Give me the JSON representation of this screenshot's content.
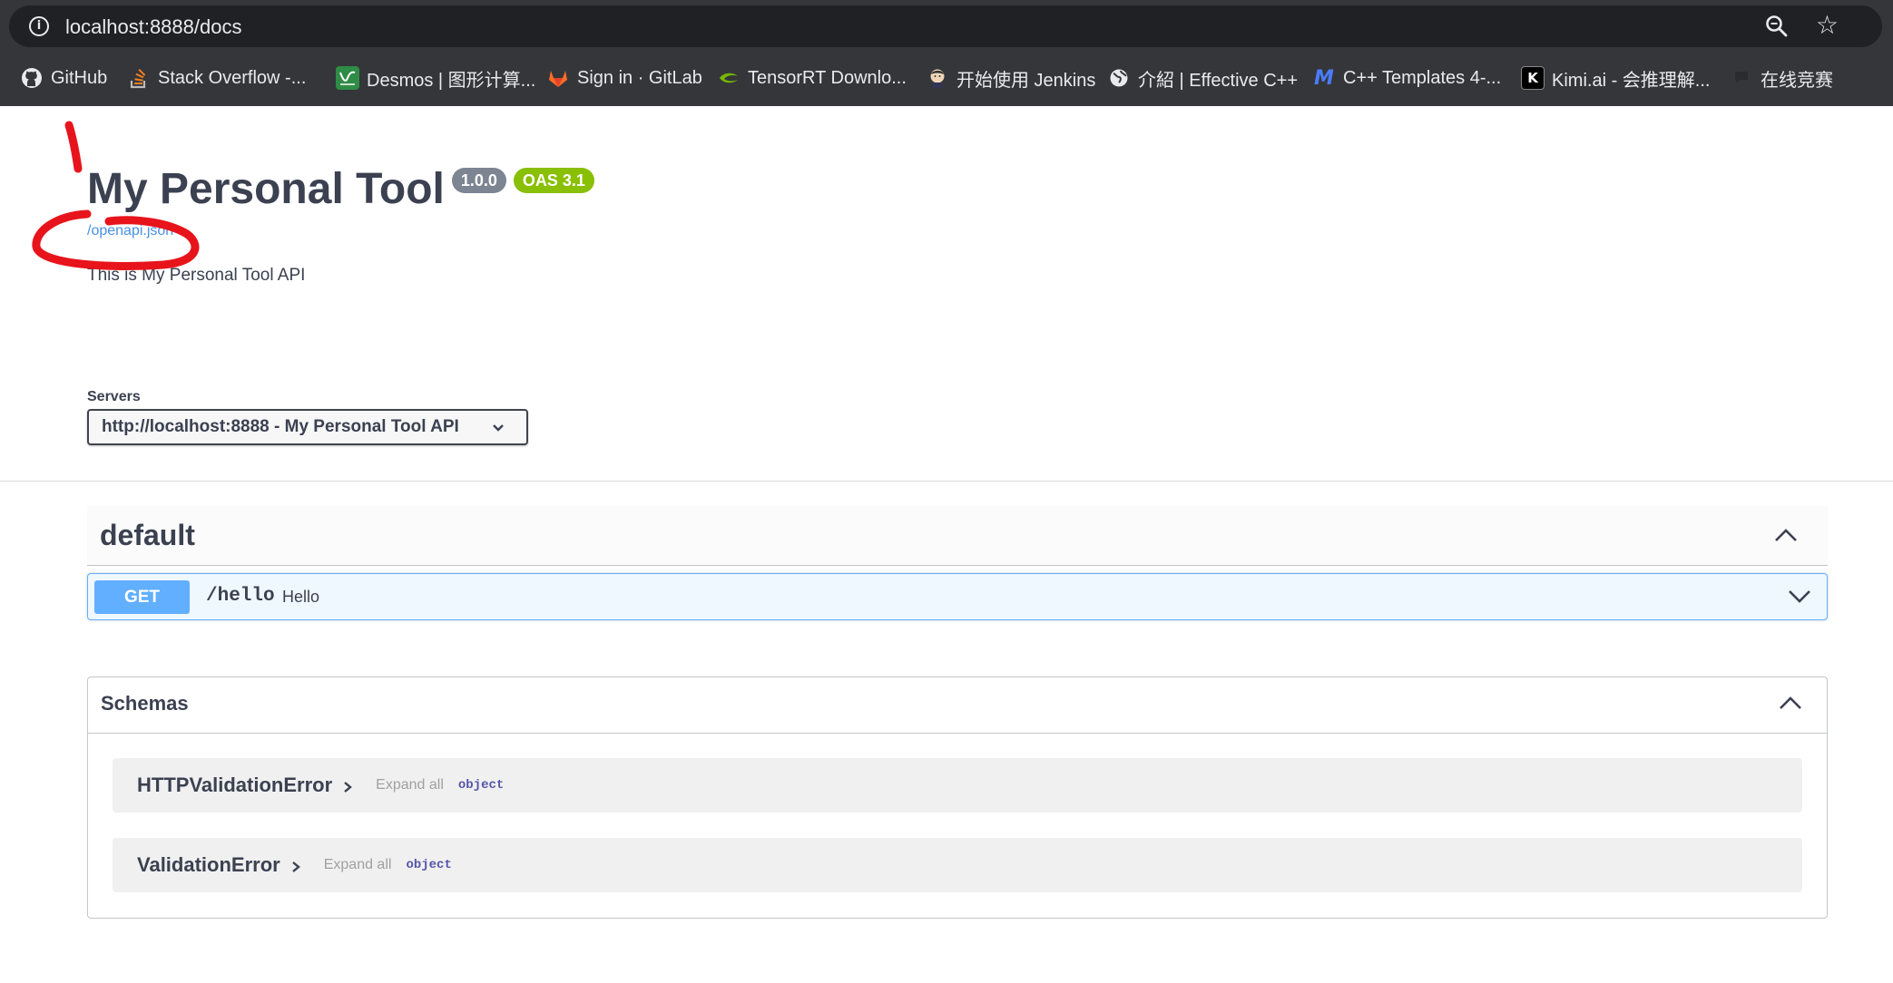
{
  "browser": {
    "url": "localhost:8888/docs",
    "bookmarks": [
      {
        "label": "GitHub",
        "icon": "github-icon"
      },
      {
        "label": "Stack Overflow -...",
        "icon": "stackoverflow-icon"
      },
      {
        "label": "Desmos | 图形计算...",
        "icon": "desmos-icon"
      },
      {
        "label": "Sign in · GitLab",
        "icon": "gitlab-icon"
      },
      {
        "label": "TensorRT Downlo...",
        "icon": "nvidia-icon"
      },
      {
        "label": "开始使用 Jenkins",
        "icon": "jenkins-icon"
      },
      {
        "label": "介紹 | Effective C++",
        "icon": "globe-icon"
      },
      {
        "label": "C++ Templates 4-...",
        "icon": "m-icon"
      },
      {
        "label": "Kimi.ai - 会推理解...",
        "icon": "kimi-icon"
      },
      {
        "label": "在线竞赛",
        "icon": "contest-icon"
      }
    ]
  },
  "info": {
    "title": "My Personal Tool",
    "version": "1.0.0",
    "oas": "OAS 3.1",
    "spec_link": "/openapi.json",
    "description": "This is My Personal Tool API"
  },
  "servers": {
    "label": "Servers",
    "selected": "http://localhost:8888 - My Personal Tool API"
  },
  "tag": {
    "name": "default",
    "operations": [
      {
        "method": "GET",
        "path": "/hello",
        "summary": "Hello"
      }
    ]
  },
  "schemas": {
    "title": "Schemas",
    "models": [
      {
        "name": "HTTPValidationError",
        "expand": "Expand all",
        "type": "object"
      },
      {
        "name": "ValidationError",
        "expand": "Expand all",
        "type": "object"
      }
    ]
  },
  "colors": {
    "get": "#61affe",
    "oas_badge": "#89bf04",
    "version_badge": "#7d8492",
    "annotation": "#e8141b"
  }
}
